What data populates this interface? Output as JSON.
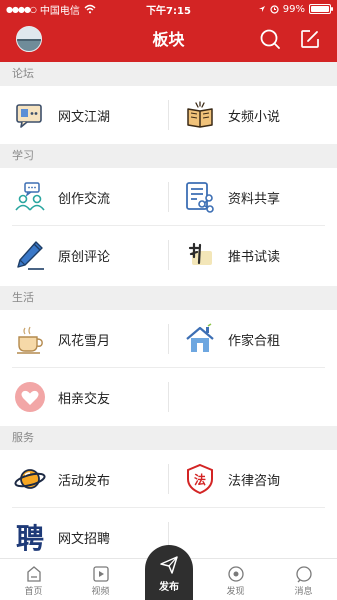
{
  "status_bar": {
    "carrier": "中国电信",
    "time": "下午7:15",
    "battery_text": "99%",
    "battery_level": 0.99
  },
  "navbar": {
    "title": "板块"
  },
  "sections": [
    {
      "title": "论坛",
      "rows": [
        [
          {
            "label": "网文江湖",
            "icon": "chat-bubble-icon"
          },
          {
            "label": "女频小说",
            "icon": "open-book-icon"
          }
        ]
      ]
    },
    {
      "title": "学习",
      "rows": [
        [
          {
            "label": "创作交流",
            "icon": "people-chat-icon"
          },
          {
            "label": "资料共享",
            "icon": "share-document-icon"
          }
        ],
        [
          {
            "label": "原创评论",
            "icon": "pen-icon"
          },
          {
            "label": "推书试读",
            "icon": "book-recommend-icon"
          }
        ]
      ]
    },
    {
      "title": "生活",
      "rows": [
        [
          {
            "label": "风花雪月",
            "icon": "coffee-cup-icon"
          },
          {
            "label": "作家合租",
            "icon": "house-icon"
          }
        ],
        [
          {
            "label": "相亲交友",
            "icon": "heart-icon"
          }
        ]
      ]
    },
    {
      "title": "服务",
      "rows": [
        [
          {
            "label": "活动发布",
            "icon": "planet-icon"
          },
          {
            "label": "法律咨询",
            "icon": "law-shield-icon"
          }
        ],
        [
          {
            "label": "网文招聘",
            "icon": "recruit-icon"
          }
        ]
      ]
    }
  ],
  "tabbar": {
    "tabs": [
      {
        "label": "首页",
        "icon": "home-icon"
      },
      {
        "label": "视频",
        "icon": "video-icon"
      },
      {
        "label": "发布",
        "icon": "paper-plane-icon"
      },
      {
        "label": "发现",
        "icon": "discover-icon"
      },
      {
        "label": "消息",
        "icon": "message-icon"
      }
    ]
  },
  "colors": {
    "brand": "#d32424",
    "section_bg": "#efefef",
    "publish_bg": "#2f2f2f"
  }
}
